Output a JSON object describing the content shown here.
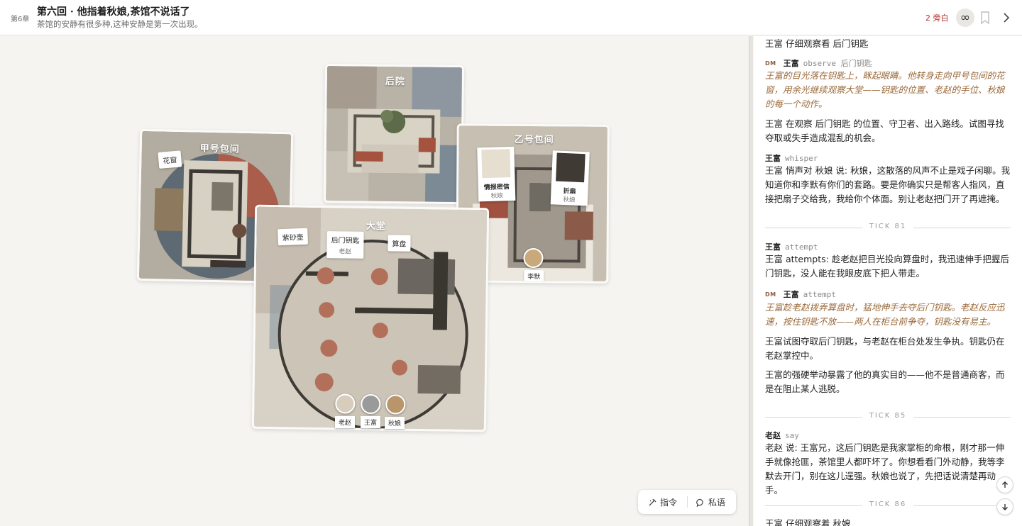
{
  "header": {
    "chapter": "第6章",
    "title": "第六回 · 他指着秋娘,茶馆不说话了",
    "subtitle": "茶馆的安静有很多种,这种安静是第一次出现。",
    "aside_count": "2 旁白",
    "infinity_symbol": "∞"
  },
  "map": {
    "rooms": {
      "backyard": "后院",
      "room_a": "甲号包间",
      "room_b": "乙号包间",
      "hall": "大堂"
    },
    "room_a_items": [
      {
        "label": "花窗"
      }
    ],
    "hall_items": [
      {
        "label": "紫砂壶"
      },
      {
        "label": "后门钥匙",
        "holder": "老赵"
      },
      {
        "label": "算盘"
      }
    ],
    "room_b_items": [
      {
        "label": "情报密信",
        "holder": "秋娘"
      },
      {
        "label": "折扇",
        "holder": "秋娘"
      }
    ],
    "characters": {
      "room_b": [
        "李默"
      ],
      "hall": [
        "老赵",
        "王富",
        "秋娘"
      ]
    },
    "commands": {
      "command": "指令",
      "whisper": "私语"
    }
  },
  "log": {
    "top_line": "王富 仔细观察看 后门钥匙",
    "e1": {
      "dm": "DM",
      "actor": "王富",
      "verb": "observe 后门钥匙",
      "narration": "王富的目光落在钥匙上，眯起眼睛。他转身走向甲号包间的花窗，用余光继续观察大堂——钥匙的位置、老赵的手位、秋娘的每一个动作。"
    },
    "t1": "王富 在观察 后门钥匙 的位置、守卫者、出入路线。试图寻找夺取或失手造成混乱的机会。",
    "e2": {
      "actor": "王富",
      "verb": "whisper",
      "text": "王富 悄声对 秋娘 说: 秋娘，这散落的风声不止是戏子闲聊。我知道你和李默有你们的套路。要是你确实只是帮客人指风，直接把扇子交给我，我给你个体面。别让老赵把门开了再遮掩。"
    },
    "tick_81": "TICK 81",
    "e3": {
      "actor": "王富",
      "verb": "attempt",
      "text": "王富 attempts: 趁老赵把目光投向算盘时，我迅速伸手把握后门钥匙，没人能在我眼皮底下把人带走。"
    },
    "e4": {
      "dm": "DM",
      "actor": "王富",
      "verb": "attempt",
      "narration": "王富趁老赵拨弄算盘时，猛地伸手去夺后门钥匙。老赵反应迅速，按住钥匙不放——两人在柜台前争夺，钥匙没有易主。"
    },
    "t2": "王富试图夺取后门钥匙，与老赵在柜台处发生争执。钥匙仍在老赵掌控中。",
    "t3": "王富的强硬举动暴露了他的真实目的——他不是普通商客，而是在阻止某人逃脱。",
    "tick_85": "TICK 85",
    "e5": {
      "actor": "老赵",
      "verb": "say",
      "text": "老赵 说: 王富兄，这后门钥匙是我家掌柜的命根，刚才那一伸手就像抢匪，茶馆里人都吓坏了。你想看看门外动静，我等李默去开门，别在这儿逞强。秋娘也说了，先把话说清楚再动手。"
    },
    "tick_86": "TICK 86",
    "bottom_line": "王富 仔细观察着 秋娘"
  },
  "colors": {
    "accent_red": "#b3322d",
    "narration": "#9b6a3a"
  }
}
